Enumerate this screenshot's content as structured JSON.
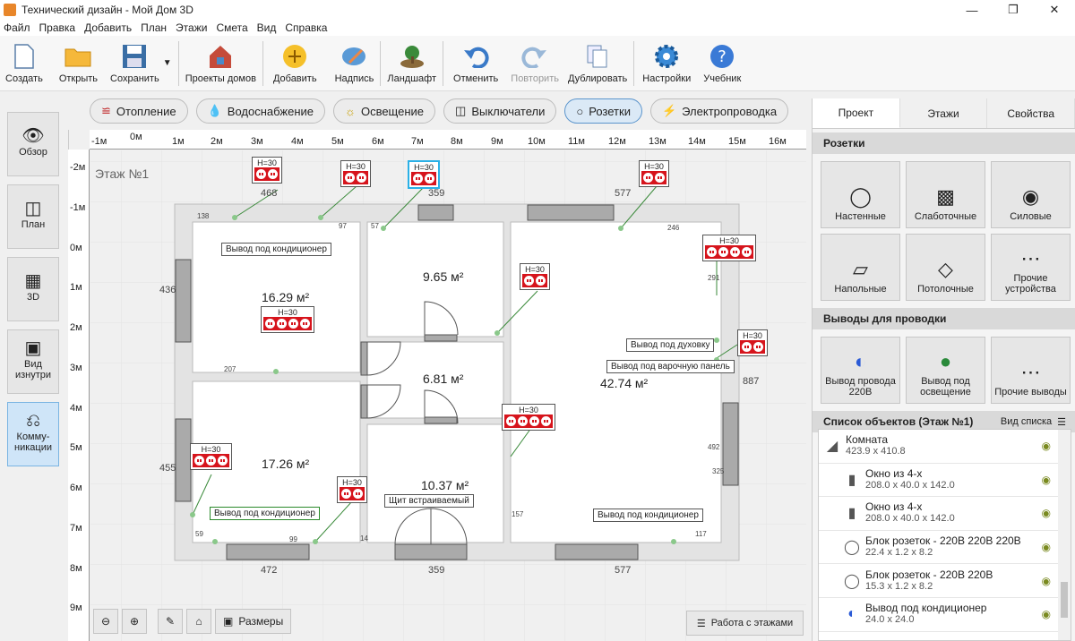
{
  "window": {
    "title": "Технический дизайн - Мой Дом 3D"
  },
  "menu": [
    "Файл",
    "Правка",
    "Добавить",
    "План",
    "Этажи",
    "Смета",
    "Вид",
    "Справка"
  ],
  "toolbar": {
    "create": "Создать",
    "open": "Открыть",
    "save": "Сохранить",
    "projects": "Проекты домов",
    "add": "Добавить",
    "label": "Надпись",
    "landscape": "Ландшафт",
    "undo": "Отменить",
    "redo": "Повторить",
    "duplicate": "Дублировать",
    "settings": "Настройки",
    "tutorial": "Учебник"
  },
  "left": [
    "Обзор",
    "План",
    "3D",
    "Вид изнутри",
    "Комму-никации"
  ],
  "categories": [
    "Отопление",
    "Водоснабжение",
    "Освещение",
    "Выключатели",
    "Розетки",
    "Электропроводка"
  ],
  "ruler": {
    "h": [
      "-1м",
      "0м",
      "1м",
      "2м",
      "3м",
      "4м",
      "5м",
      "6м",
      "7м",
      "8м",
      "9м",
      "10м",
      "11м",
      "12м",
      "13м",
      "14м",
      "15м",
      "16м"
    ],
    "v": [
      "-2м",
      "-1м",
      "0м",
      "1м",
      "2м",
      "3м",
      "4м",
      "5м",
      "6м",
      "7м",
      "8м",
      "9м"
    ]
  },
  "plan": {
    "floor_label": "Этаж №1",
    "rooms": [
      "16.29 м²",
      "9.65 м²",
      "6.81 м²",
      "42.74 м²",
      "17.26 м²",
      "10.37 м²"
    ],
    "socket_h": "H=30",
    "tags": [
      "Вывод под кондиционер",
      "Вывод под кондиционер",
      "Вывод под духовку",
      "Вывод под варочную панель",
      "Вывод под кондиционер",
      "Щит встраиваемый"
    ],
    "dims": [
      "468",
      "359",
      "577",
      "472",
      "359",
      "577",
      "436",
      "455",
      "887",
      "138",
      "97",
      "57",
      "246",
      "207",
      "59",
      "99",
      "14",
      "117",
      "157",
      "291",
      "492",
      "325"
    ]
  },
  "bottom": {
    "measures": "Размеры",
    "floors": "Работа с этажами"
  },
  "panel": {
    "tabs": [
      "Проект",
      "Этажи",
      "Свойства"
    ],
    "sockets_title": "Розетки",
    "sockets": [
      "Настенные",
      "Слаботочные",
      "Силовые",
      "Напольные",
      "Потолочные",
      "Прочие устройства"
    ],
    "outputs_title": "Выводы для проводки",
    "outputs": [
      "Вывод провода 220В",
      "Вывод под освещение",
      "Прочие выводы"
    ],
    "list_title": "Список объектов (Этаж №1)",
    "list_view": "Вид списка",
    "objects": [
      {
        "name": "Комната",
        "size": "423.9 x 410.8"
      },
      {
        "name": "Окно из 4-х",
        "size": "208.0 x 40.0 x 142.0"
      },
      {
        "name": "Окно из 4-х",
        "size": "208.0 x 40.0 x 142.0"
      },
      {
        "name": "Блок розеток - 220В 220В 220В",
        "size": "22.4 x 1.2 x 8.2"
      },
      {
        "name": "Блок розеток - 220В 220В",
        "size": "15.3 x 1.2 x 8.2"
      },
      {
        "name": "Вывод под кондиционер",
        "size": "24.0 x 24.0"
      }
    ]
  }
}
